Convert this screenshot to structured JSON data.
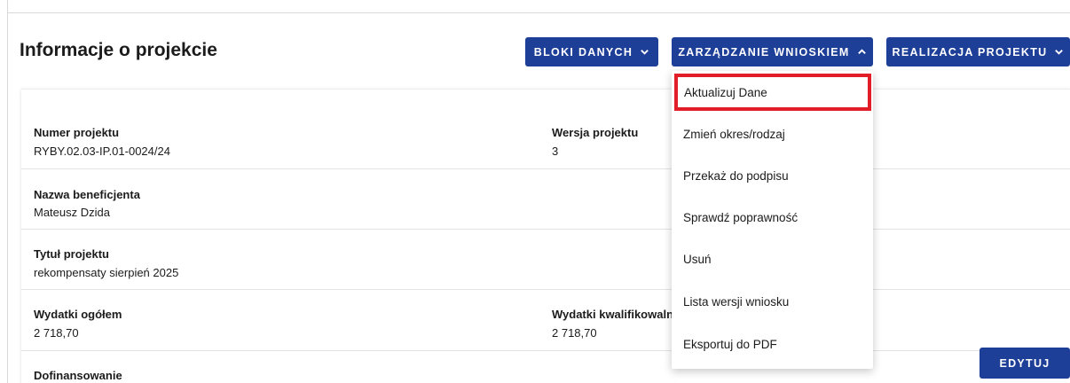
{
  "page": {
    "title": "Informacje o projekcie"
  },
  "toolbar": {
    "bloki_label": "BLOKI DANYCH",
    "zarzadzanie_label": "ZARZĄDZANIE WNIOSKIEM",
    "realizacja_label": "REALIZACJA PROJEKTU"
  },
  "fields": {
    "numer_label": "Numer projektu",
    "numer_value": "RYBY.02.03-IP.01-0024/24",
    "wersja_label": "Wersja projektu",
    "wersja_value": "3",
    "beneficjent_label": "Nazwa beneficjenta",
    "beneficjent_value": "Mateusz Dzida",
    "tytul_label": "Tytuł projektu",
    "tytul_value": "rekompensaty sierpień 2025",
    "wydatki_label": "Wydatki ogółem",
    "wydatki_value": "2 718,70",
    "kwalif_label": "Wydatki kwalifikowaln",
    "kwalif_value": "2 718,70",
    "dofinansowanie_label": "Dofinansowanie"
  },
  "dropdown": {
    "items": [
      "Aktualizuj Dane",
      "Zmień okres/rodzaj",
      "Przekaż do podpisu",
      "Sprawdź poprawność",
      "Usuń",
      "Lista wersji wniosku",
      "Eksportuj do PDF"
    ],
    "highlighted_index": 0
  },
  "actions": {
    "edytuj_label": "EDYTUJ"
  },
  "colors": {
    "primary": "#1e3f98",
    "highlight_border": "#e21d27"
  }
}
